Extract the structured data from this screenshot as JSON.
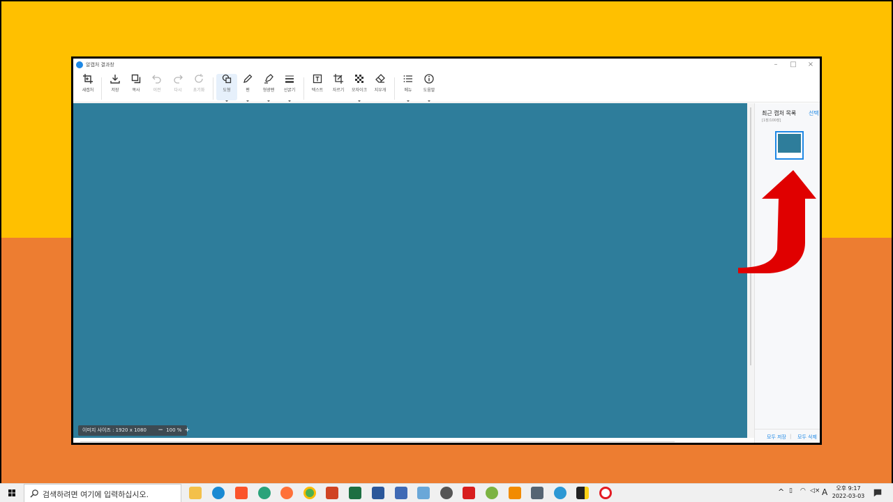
{
  "window": {
    "title": "알캡처 결과창",
    "controls": [
      "minimize",
      "maximize",
      "close"
    ]
  },
  "toolbar": {
    "new_capture": "새캡처",
    "save": "저장",
    "copy": "복사",
    "undo": "이전",
    "redo": "다시",
    "reset": "초기화",
    "shape": "도형",
    "pen": "펜",
    "highlighter": "형광펜",
    "line_width": "선굵기",
    "text": "텍스트",
    "crop": "자르기",
    "mosaic": "모자이크",
    "eraser": "지우개",
    "menu": "메뉴",
    "help": "도움말"
  },
  "status": {
    "image_size": "이미지 사이즈 : 1920 x 1080",
    "zoom_out": "−",
    "zoom": "100 %",
    "zoom_in": "+"
  },
  "sidebar": {
    "title": "최근 캡처 목록",
    "select": "선택",
    "count": "[1장/100장]",
    "save_all": "모두 저장",
    "delete_all": "모두 삭제"
  },
  "taskbar": {
    "search_placeholder": "검색하려면 여기에 입력하십시오.",
    "time": "오후 9:17",
    "date": "2022-03-03",
    "ime": "A",
    "apps": [
      "file-explorer",
      "edge",
      "brave",
      "app-green",
      "firefox",
      "chrome",
      "powerpoint",
      "excel",
      "word",
      "app-h",
      "app-remote",
      "app-search",
      "app-se",
      "app-android",
      "vlc",
      "calculator",
      "edge-beta",
      "sticky-notes",
      "opera"
    ]
  },
  "colors": {
    "canvas": "#2e7d9b",
    "accent": "#1e88e5",
    "top_band": "#ffc000",
    "bottom_band": "#ed7d31",
    "arrow": "#e00000"
  }
}
